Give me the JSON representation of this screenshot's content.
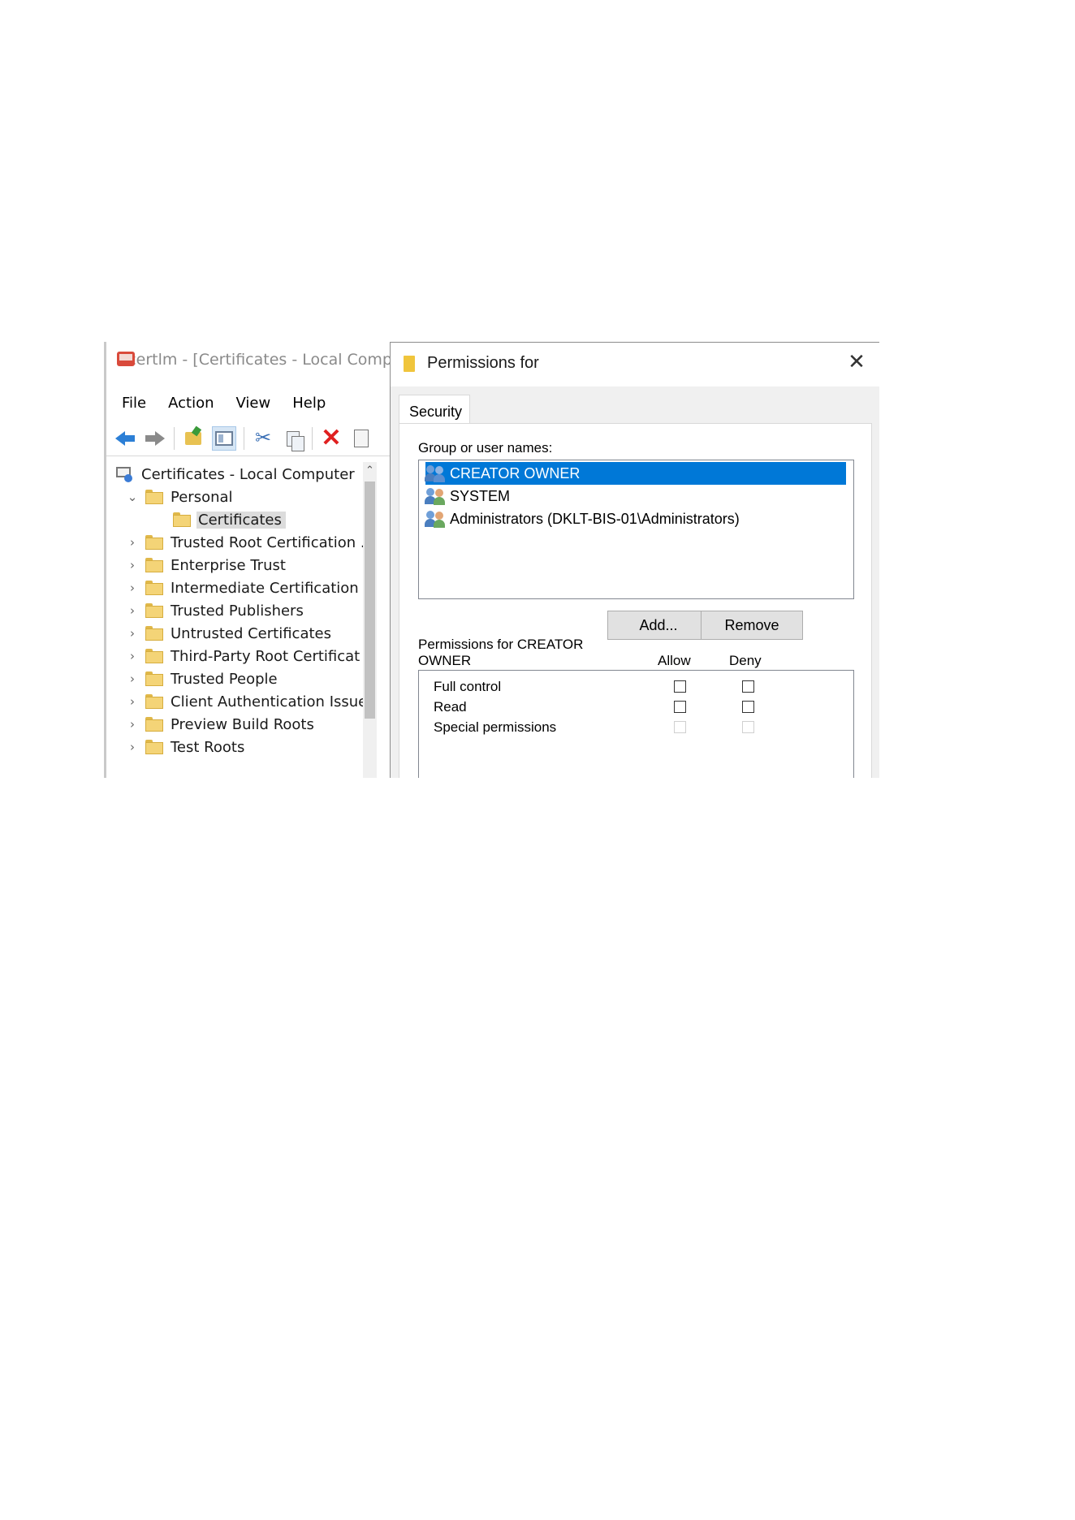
{
  "mmc": {
    "title": "certlm - [Certificates - Local Comp",
    "menu": [
      "File",
      "Action",
      "View",
      "Help"
    ],
    "toolbar_icons": [
      "back-arrow-icon",
      "forward-arrow-icon",
      "up-folder-icon",
      "show-hide-tree-icon",
      "cut-icon",
      "copy-icon",
      "delete-icon",
      "properties-icon"
    ],
    "tree": {
      "root": "Certificates - Local Computer",
      "items": [
        {
          "label": "Personal",
          "expanded": true
        },
        {
          "label": "Certificates",
          "selected": true
        },
        {
          "label": "Trusted Root Certification ."
        },
        {
          "label": "Enterprise Trust"
        },
        {
          "label": "Intermediate Certification ."
        },
        {
          "label": "Trusted Publishers"
        },
        {
          "label": "Untrusted Certificates"
        },
        {
          "label": "Third-Party Root Certificat"
        },
        {
          "label": "Trusted People"
        },
        {
          "label": "Client Authentication Issue"
        },
        {
          "label": "Preview Build Roots"
        },
        {
          "label": "Test Roots"
        }
      ]
    }
  },
  "dialog": {
    "title": "Permissions for",
    "close_glyph": "✕",
    "tab": "Security",
    "group_label": "Group or user names:",
    "users": [
      {
        "name": "CREATOR OWNER",
        "selected": true
      },
      {
        "name": "SYSTEM"
      },
      {
        "name": "Administrators (DKLT-BIS-01\\Administrators)"
      }
    ],
    "add_button": "Add...",
    "remove_button": "Remove",
    "permissions_label_line1": "Permissions for CREATOR",
    "permissions_label_line2": "OWNER",
    "allow_header": "Allow",
    "deny_header": "Deny",
    "permissions": [
      {
        "name": "Full control",
        "allow": false,
        "deny": false,
        "enabled": true
      },
      {
        "name": "Read",
        "allow": false,
        "deny": false,
        "enabled": true
      },
      {
        "name": "Special permissions",
        "allow": false,
        "deny": false,
        "enabled": false
      }
    ]
  },
  "colors": {
    "selection_blue": "#0078d7",
    "folder_yellow": "#f4d477",
    "delete_red": "#e02020"
  }
}
